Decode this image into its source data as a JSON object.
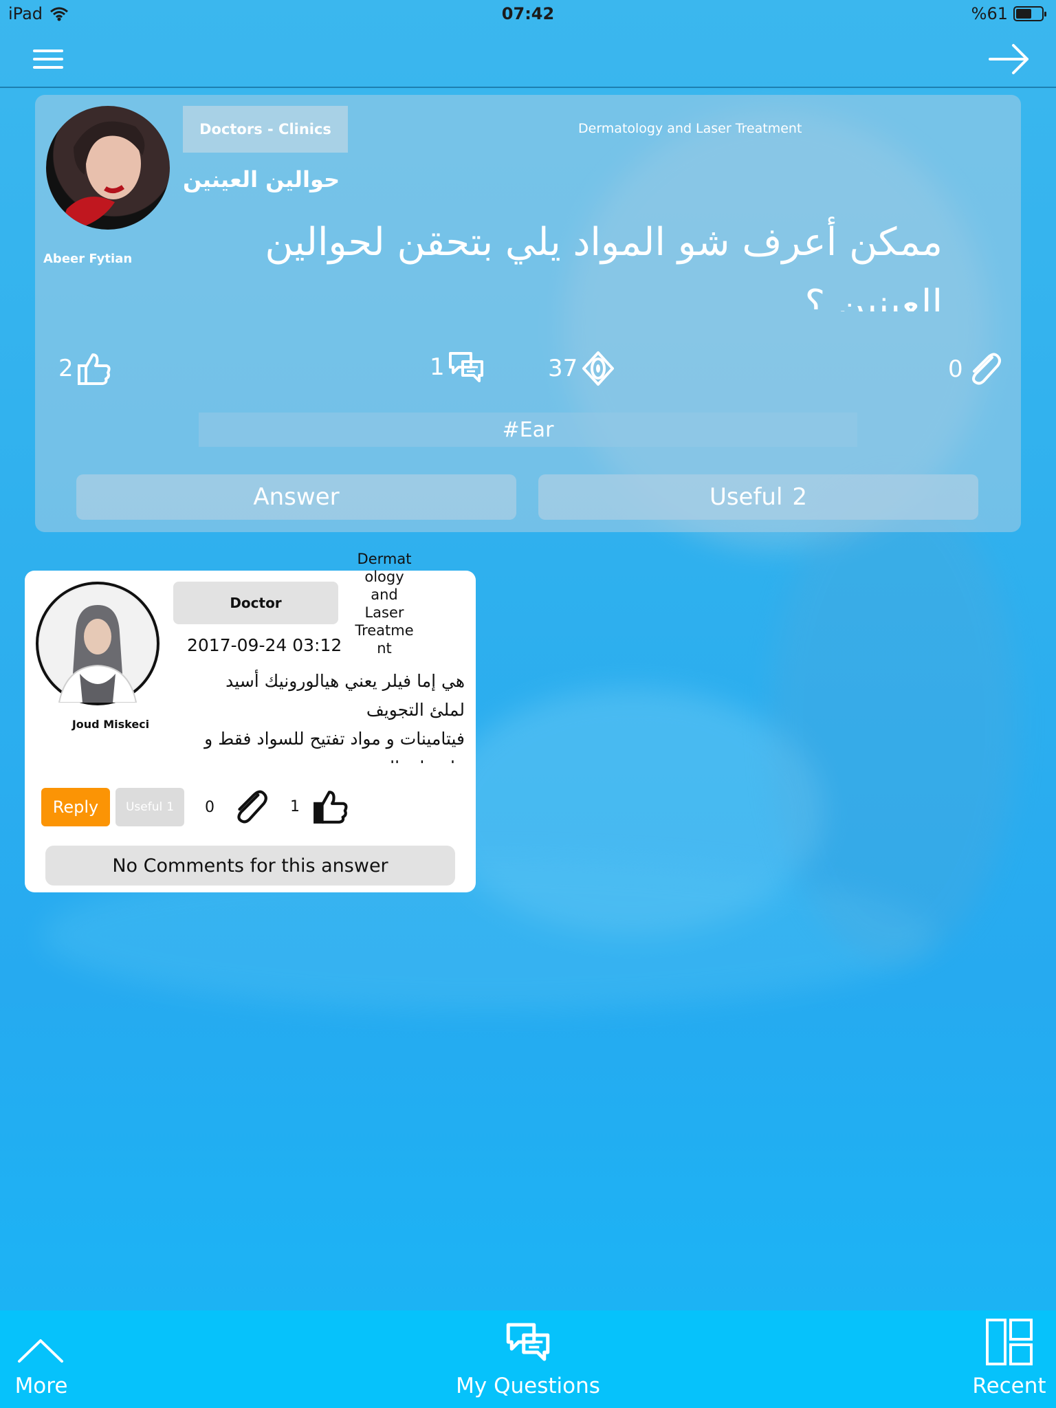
{
  "status_bar": {
    "device": "iPad",
    "time": "07:42",
    "battery_text": "%61",
    "battery_level": 0.61
  },
  "navbar": {
    "menu_icon": "hamburger-menu-icon",
    "forward_icon": "arrow-right-icon"
  },
  "question": {
    "author": "Abeer Fytian",
    "category": "Doctors - Clinics",
    "subcategory": "Dermatology and Laser Treatment",
    "title": "حوالين العينين",
    "body": "ممكن أعرف شو المواد يلي بتحقن لحوالين العينين ؟",
    "likes": "2",
    "answers": "1",
    "views": "37",
    "attachments": "0",
    "tag": "#Ear",
    "answer_label": "Answer",
    "useful_label": "Useful",
    "useful_count": "2"
  },
  "answer": {
    "author": "Joud Miskeci",
    "role": "Doctor",
    "specialty": "Dermat ology and Laser Treatme nt",
    "date": "2017-09-24 03:12",
    "body": "هي إما فيلر يعني هيالورونيك أسيد لملئ التجويف\nفيتامينات و مواد تفتيح للسواد فقط و ما بتملئ التجويف",
    "reply_label": "Reply",
    "useful_label": "Useful",
    "useful_count": "1",
    "attachments": "0",
    "likes": "1",
    "comments_text": "No Comments for this answer"
  },
  "tabbar": {
    "more_label": "More",
    "my_questions_label": "My Questions",
    "recent_label": "Recent"
  },
  "colors": {
    "background": "#2fb0ee",
    "tabbar": "#06c2fb",
    "reply_button": "#fb9405"
  }
}
